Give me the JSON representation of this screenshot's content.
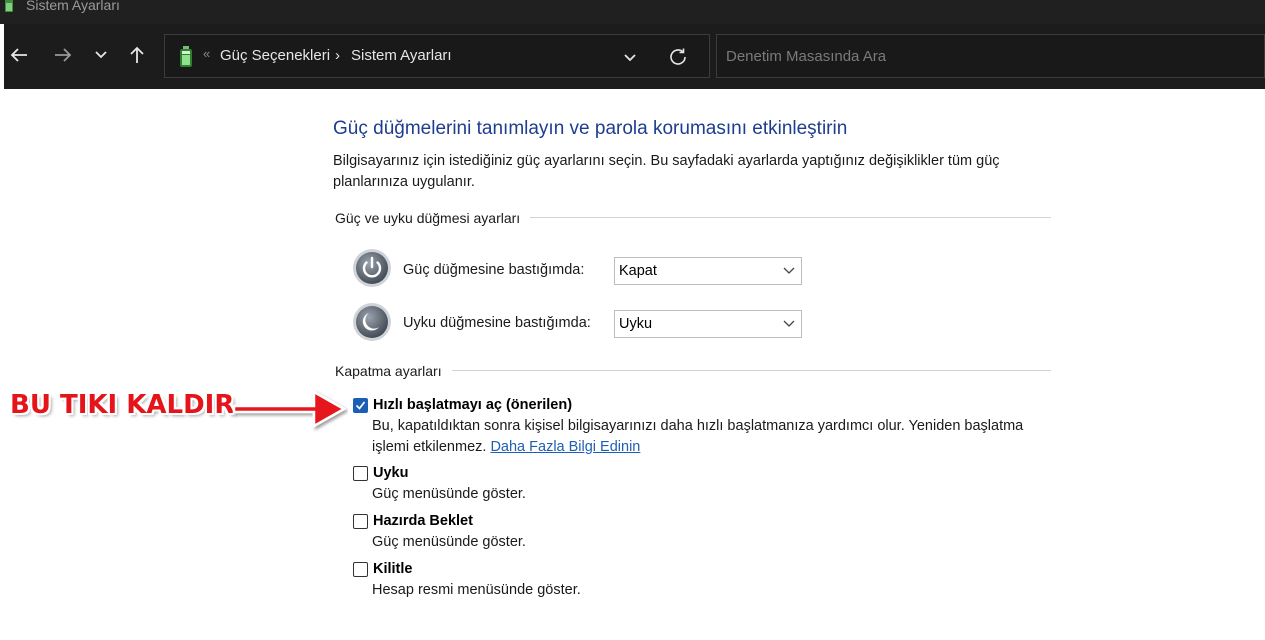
{
  "window": {
    "title": "Sistem Ayarları"
  },
  "addressbar": {
    "separator": "«",
    "crumbs": [
      "Güç Seçenekleri",
      "Sistem Ayarları"
    ],
    "crumb_arrow": "›"
  },
  "search": {
    "placeholder": "Denetim Masasında Ara"
  },
  "main": {
    "title": "Güç düğmelerini tanımlayın ve parola korumasını etkinleştirin",
    "description": "Bilgisayarınız için istediğiniz güç ayarlarını seçin. Bu sayfadaki ayarlarda yaptığınız değişiklikler tüm güç planlarınıza uygulanır.",
    "power_group": {
      "header": "Güç ve uyku düğmesi ayarları",
      "rows": [
        {
          "label": "Güç düğmesine bastığımda:",
          "value": "Kapat"
        },
        {
          "label": "Uyku düğmesine bastığımda:",
          "value": "Uyku"
        }
      ]
    },
    "shutdown_group": {
      "header": "Kapatma ayarları",
      "options": [
        {
          "label": "Hızlı başlatmayı aç (önerilen)",
          "checked": true,
          "description": "Bu, kapatıldıktan sonra kişisel bilgisayarınızı daha hızlı başlatmanıza yardımcı olur. Yeniden başlatma işlemi etkilenmez.",
          "link": "Daha Fazla Bilgi Edinin"
        },
        {
          "label": "Uyku",
          "checked": false,
          "description": "Güç menüsünde göster."
        },
        {
          "label": "Hazırda Beklet",
          "checked": false,
          "description": "Güç menüsünde göster."
        },
        {
          "label": "Kilitle",
          "checked": false,
          "description": "Hesap resmi menüsünde göster."
        }
      ]
    }
  },
  "annotation": {
    "text": "BU TIKI KALDIR",
    "color": "#e5141a"
  },
  "colors": {
    "title_blue": "#1e3d8f",
    "link_blue": "#1f5fb3",
    "checkbox_blue": "#1a5fb4",
    "dark_chrome": "#1c1c1c"
  },
  "icons": {
    "back": "arrow-left-icon",
    "forward": "arrow-right-icon",
    "recent": "chevron-down-icon",
    "up": "arrow-up-icon",
    "refresh": "refresh-icon",
    "power": "power-button-icon",
    "sleep": "sleep-button-icon",
    "battery": "battery-icon"
  }
}
